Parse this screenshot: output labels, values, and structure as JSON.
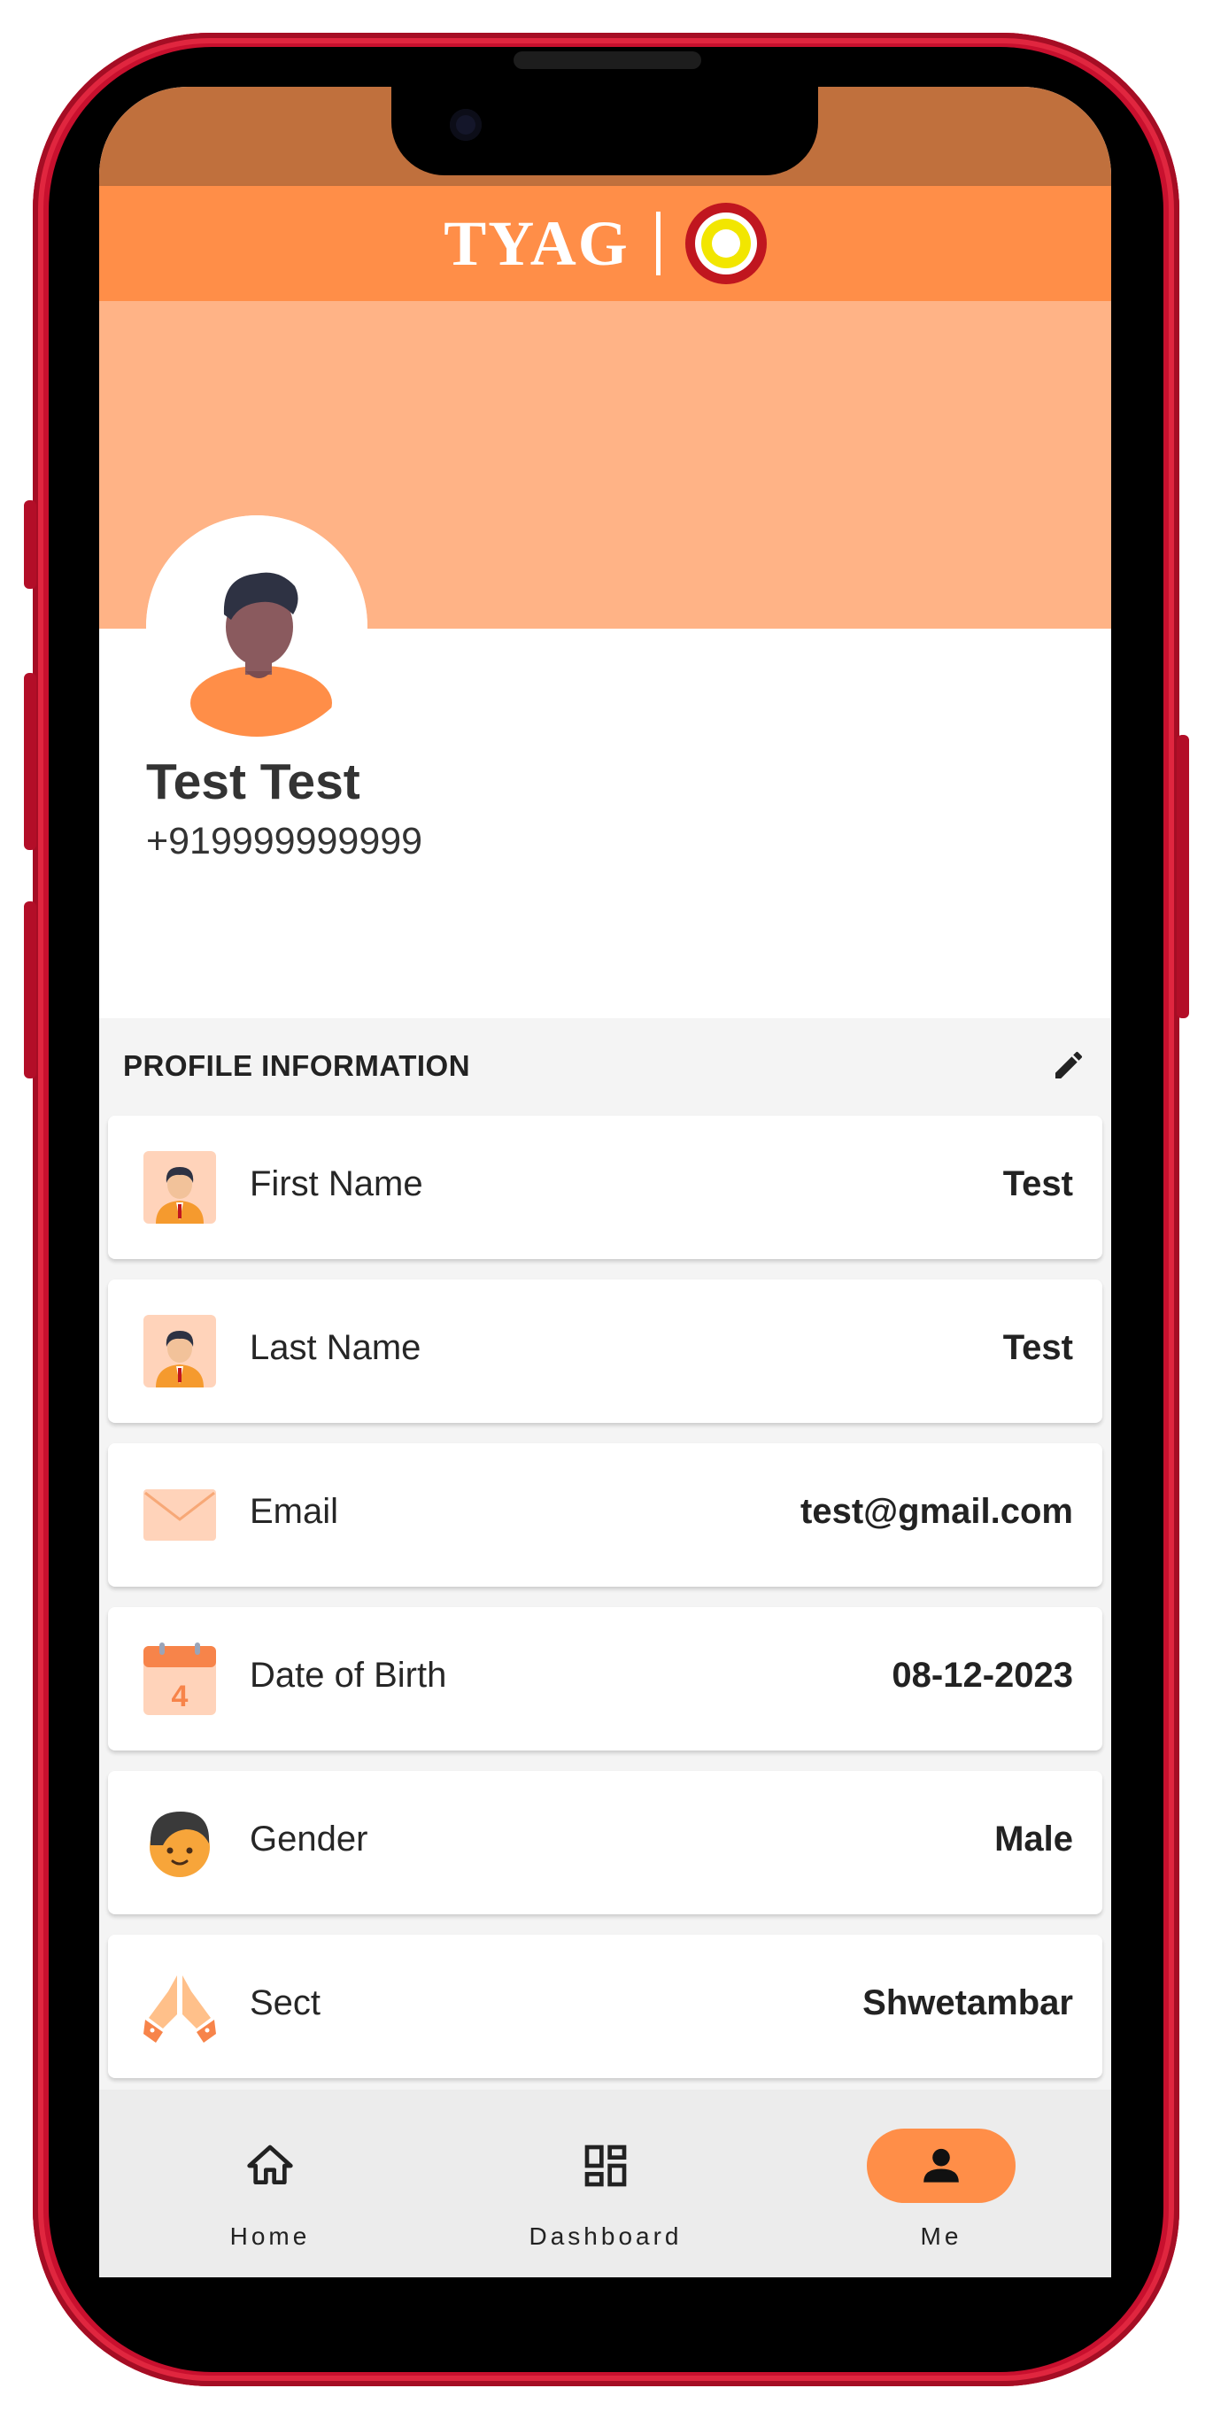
{
  "app": {
    "brand": "TYAG",
    "brand_separator": "|",
    "brand_color": "#ff8e48"
  },
  "profile": {
    "name": "Test Test",
    "phone": "+919999999999"
  },
  "section": {
    "title": "PROFILE INFORMATION",
    "edit_icon": "pencil-icon"
  },
  "fields": [
    {
      "label": "First Name",
      "value": "Test",
      "icon": "man-avatar-icon"
    },
    {
      "label": "Last Name",
      "value": "Test",
      "icon": "man-avatar-icon"
    },
    {
      "label": "Email",
      "value": "test@gmail.com",
      "icon": "envelope-icon"
    },
    {
      "label": "Date of Birth",
      "value": "08-12-2023",
      "icon": "calendar-icon",
      "icon_text": "4"
    },
    {
      "label": "Gender",
      "value": "Male",
      "icon": "boy-face-icon"
    },
    {
      "label": "Sect",
      "value": "Shwetambar",
      "icon": "folded-hands-icon"
    }
  ],
  "nav": {
    "items": [
      {
        "label": "Home",
        "icon": "home-icon",
        "active": false
      },
      {
        "label": "Dashboard",
        "icon": "dashboard-icon",
        "active": false
      },
      {
        "label": "Me",
        "icon": "person-icon",
        "active": true
      }
    ],
    "active_color": "#ff8e48"
  }
}
